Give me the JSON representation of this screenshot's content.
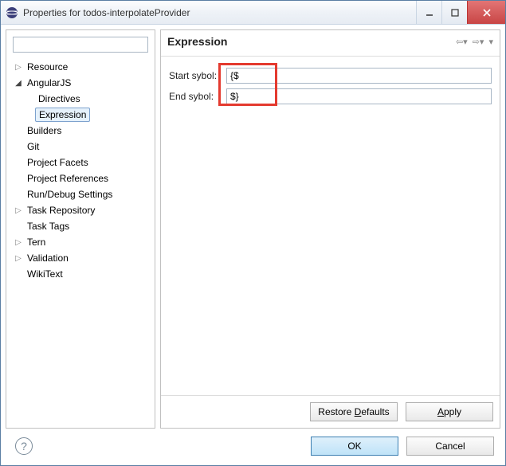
{
  "window": {
    "title": "Properties for todos-interpolateProvider"
  },
  "tree": {
    "items": [
      {
        "label": "Resource",
        "depth": 0,
        "arrow": "collapsed"
      },
      {
        "label": "AngularJS",
        "depth": 0,
        "arrow": "expanded"
      },
      {
        "label": "Directives",
        "depth": 1,
        "arrow": "none"
      },
      {
        "label": "Expression",
        "depth": 1,
        "arrow": "none",
        "selected": true
      },
      {
        "label": "Builders",
        "depth": 0,
        "arrow": "none"
      },
      {
        "label": "Git",
        "depth": 0,
        "arrow": "none"
      },
      {
        "label": "Project Facets",
        "depth": 0,
        "arrow": "none"
      },
      {
        "label": "Project References",
        "depth": 0,
        "arrow": "none"
      },
      {
        "label": "Run/Debug Settings",
        "depth": 0,
        "arrow": "none"
      },
      {
        "label": "Task Repository",
        "depth": 0,
        "arrow": "collapsed"
      },
      {
        "label": "Task Tags",
        "depth": 0,
        "arrow": "none"
      },
      {
        "label": "Tern",
        "depth": 0,
        "arrow": "collapsed"
      },
      {
        "label": "Validation",
        "depth": 0,
        "arrow": "collapsed"
      },
      {
        "label": "WikiText",
        "depth": 0,
        "arrow": "none"
      }
    ]
  },
  "page": {
    "heading": "Expression",
    "start_label": "Start sybol:",
    "start_value": "{$",
    "end_label": "End sybol:",
    "end_value": "$}",
    "restore_defaults": "Restore Defaults",
    "apply": "Apply"
  },
  "dialog": {
    "ok": "OK",
    "cancel": "Cancel"
  }
}
